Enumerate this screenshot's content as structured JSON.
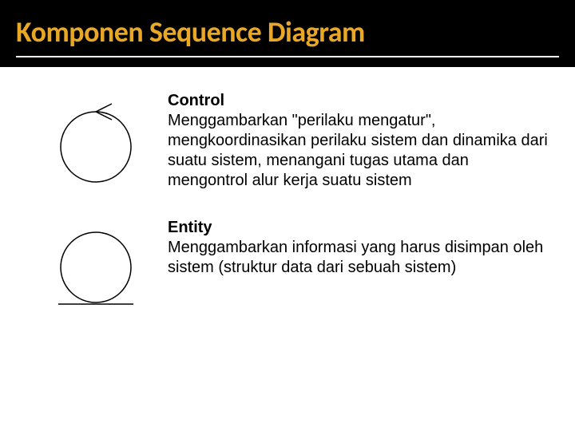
{
  "slide": {
    "title": "Komponen Sequence Diagram"
  },
  "items": [
    {
      "heading": "Control",
      "body": "Menggambarkan \"perilaku mengatur\", mengkoordinasikan perilaku sistem dan dinamika dari suatu sistem, menangani tugas utama dan mengontrol alur kerja suatu sistem"
    },
    {
      "heading": "Entity",
      "body": "Menggambarkan informasi yang harus disimpan oleh sistem (struktur data dari sebuah sistem)"
    }
  ]
}
